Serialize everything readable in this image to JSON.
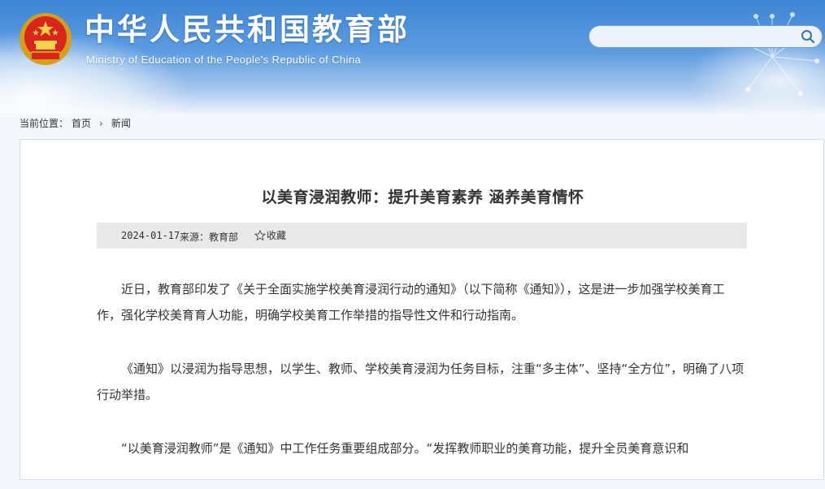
{
  "header": {
    "title": "中华人民共和国教育部",
    "subtitle": "Ministry of Education of the People's Republic of China",
    "emblem_icon": "national-emblem-icon"
  },
  "search": {
    "value": "",
    "placeholder": "",
    "icon": "search-icon"
  },
  "breadcrumb": {
    "prefix": "当前位置：",
    "items": [
      "首页",
      "新闻"
    ],
    "separator": "›"
  },
  "article": {
    "title": "以美育浸润教师：提升美育素养 涵养美育情怀",
    "date": "2024-01-17",
    "source_label": "来源：",
    "source": "教育部",
    "favorite_label": "收藏",
    "paragraphs": [
      "近日，教育部印发了《关于全面实施学校美育浸润行动的通知》（以下简称《通知》），这是进一步加强学校美育工作，强化学校美育育人功能，明确学校美育工作举措的指导性文件和行动指南。",
      "《通知》以浸润为指导思想，以学生、教师、学校美育浸润为任务目标，注重“多主体”、坚持“全方位”，明确了八项行动举措。",
      "“以美育浸润教师”是《通知》中工作任务重要组成部分。“发挥教师职业的美育功能，提升全员美育意识和"
    ]
  },
  "colors": {
    "header_blue": "#3f86d6",
    "title_white": "#ffffff",
    "meta_bar": "#e9e9e9",
    "text": "#333333"
  }
}
